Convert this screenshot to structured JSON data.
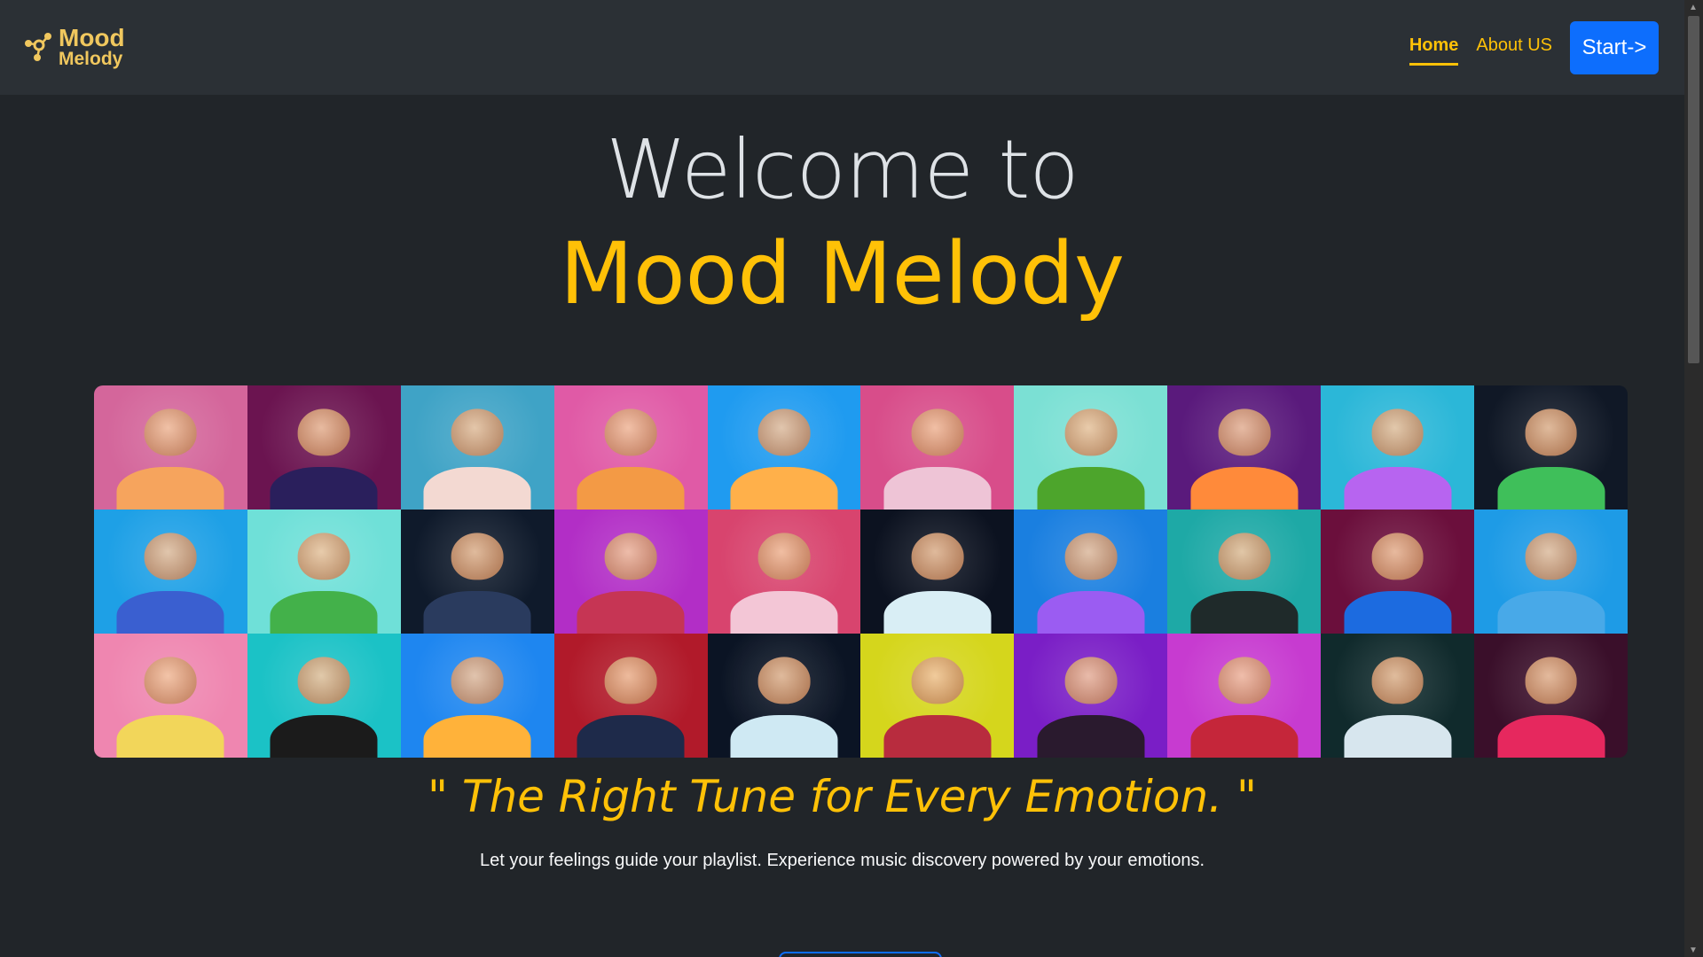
{
  "navbar": {
    "brand_line1": "Mood",
    "brand_line2": "Melody",
    "links": [
      {
        "label": "Home",
        "active": true
      },
      {
        "label": "About US",
        "active": false
      }
    ],
    "start_label": "Start->"
  },
  "hero": {
    "welcome": "Welcome to",
    "brand": "Mood Melody"
  },
  "collage": {
    "tiles": [
      {
        "bg": "#d4669b",
        "body": "#f6a45d"
      },
      {
        "bg": "#6b1450",
        "body": "#2a1f5c"
      },
      {
        "bg": "#3fa3c6",
        "body": "#f3d9d2"
      },
      {
        "bg": "#e05aa6",
        "body": "#f39a45"
      },
      {
        "bg": "#1f9bf0",
        "body": "#ffb04a"
      },
      {
        "bg": "#d84d8a",
        "body": "#eec4d6"
      },
      {
        "bg": "#7be0d4",
        "body": "#4da52c"
      },
      {
        "bg": "#5a1a7c",
        "body": "#ff8a3a"
      },
      {
        "bg": "#2bb7d8",
        "body": "#b764f0"
      },
      {
        "bg": "#101826",
        "body": "#3fbf5a"
      },
      {
        "bg": "#1ea0e6",
        "body": "#3a5fd0"
      },
      {
        "bg": "#6fe0d8",
        "body": "#43b14a"
      },
      {
        "bg": "#0f1a2b",
        "body": "#2a3b5e"
      },
      {
        "bg": "#b22ec6",
        "body": "#c63554"
      },
      {
        "bg": "#d8446e",
        "body": "#f3c6d6"
      },
      {
        "bg": "#0c1220",
        "body": "#d9eef5"
      },
      {
        "bg": "#1a7fe0",
        "body": "#9b5cf2"
      },
      {
        "bg": "#1ea9a6",
        "body": "#1f2a2a"
      },
      {
        "bg": "#6b0f3c",
        "body": "#1c6be0"
      },
      {
        "bg": "#1e9be6",
        "body": "#48a9e8"
      },
      {
        "bg": "#ef86b0",
        "body": "#f2d65a"
      },
      {
        "bg": "#1bc2c6",
        "body": "#1b1b1b"
      },
      {
        "bg": "#1e86f0",
        "body": "#ffb23a"
      },
      {
        "bg": "#b11a2a",
        "body": "#1e2a4a"
      },
      {
        "bg": "#0b1424",
        "body": "#cfe9f3"
      },
      {
        "bg": "#d5d61c",
        "body": "#b82c3e"
      },
      {
        "bg": "#7a1ec6",
        "body": "#2a1a2e"
      },
      {
        "bg": "#c73bd0",
        "body": "#c5263a"
      },
      {
        "bg": "#102a2c",
        "body": "#d7e6ee"
      },
      {
        "bg": "#3a0f2a",
        "body": "#e6285e"
      }
    ]
  },
  "tagline": "\" The Right Tune for Every Emotion. \"",
  "subtext": "Let your feelings guide your playlist. Experience music discovery powered by your emotions.",
  "colors": {
    "accent": "#ffc107",
    "primary_button": "#0d6efd",
    "background": "#212529",
    "navbar": "#2b3035"
  }
}
